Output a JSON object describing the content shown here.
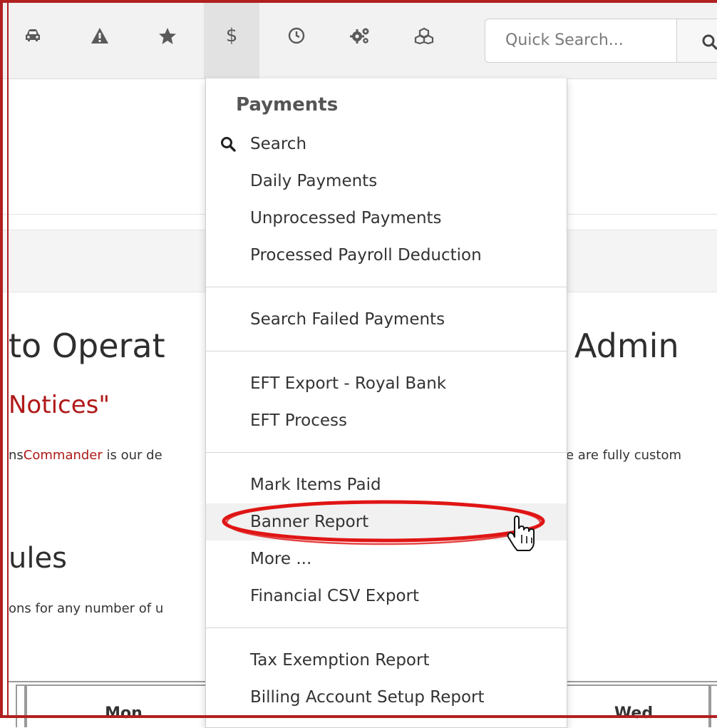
{
  "toolbar": {
    "icons": [
      "car-icon",
      "warning-icon",
      "star-icon",
      "dollar-icon",
      "clock-icon",
      "cogs-icon",
      "cubes-icon"
    ],
    "dollar_symbol": "$",
    "search_placeholder": "Quick Search..."
  },
  "page": {
    "welcome_left": "to Operat",
    "welcome_right": "Admin",
    "notices": "Notices\"",
    "desc_prefix": "ns",
    "desc_brand": "Commander",
    "desc_mid": " is our de",
    "desc_right": "e are fully custom",
    "modules": "ules",
    "modules_desc": "ons for any number of u",
    "calendar": [
      "Mon",
      "Wed"
    ]
  },
  "dropdown": {
    "header": "Payments",
    "groups": [
      [
        "Search",
        "Daily Payments",
        "Unprocessed Payments",
        "Processed Payroll Deduction"
      ],
      [
        "Search Failed Payments"
      ],
      [
        "EFT Export - Royal Bank",
        "EFT Process"
      ],
      [
        "Mark Items Paid",
        "Banner Report",
        "More ...",
        "Financial CSV Export"
      ],
      [
        "Tax Exemption Report",
        "Billing Account Setup Report"
      ]
    ],
    "highlighted_item": "Banner Report"
  },
  "colors": {
    "accent_red": "#b01818",
    "annotation_red": "#e01515",
    "frame_red": "#b02020"
  }
}
